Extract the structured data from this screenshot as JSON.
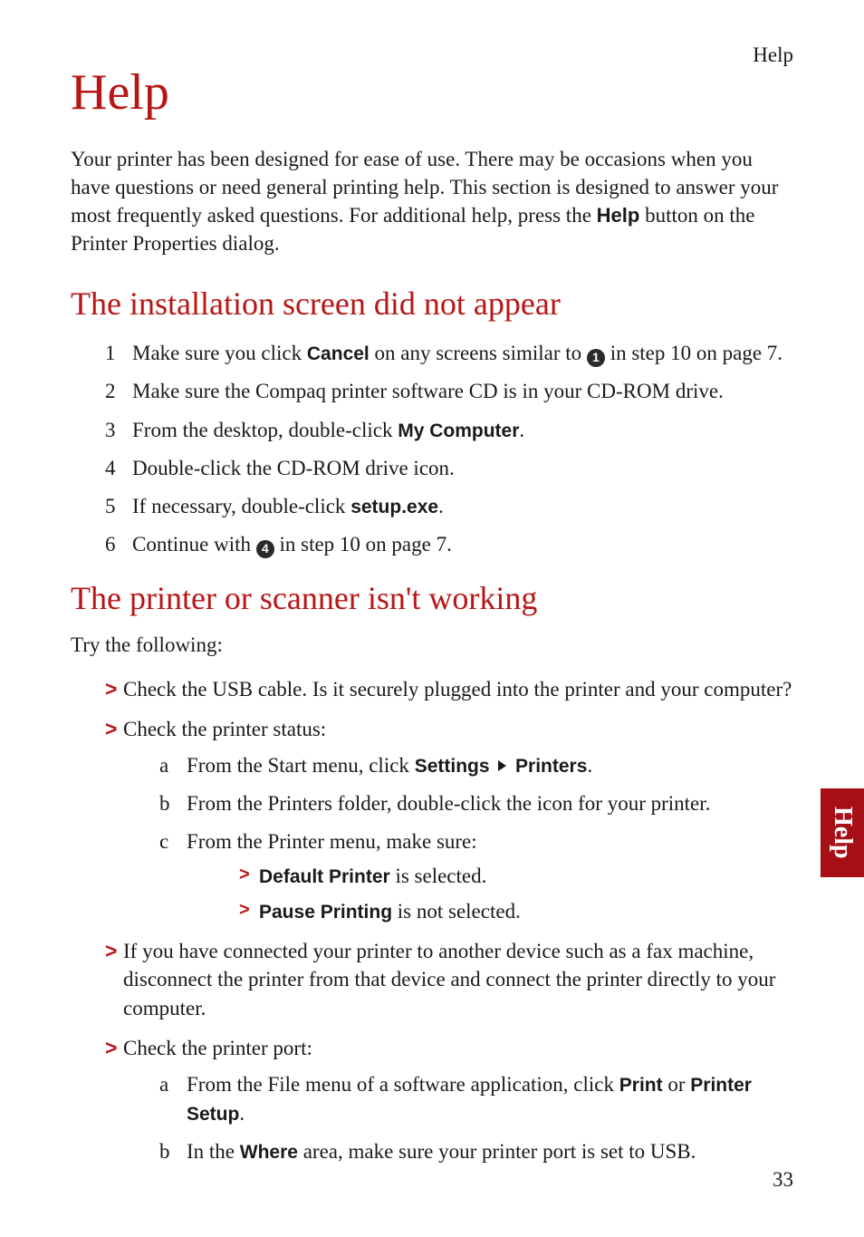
{
  "header": {
    "label": "Help"
  },
  "title": "Help",
  "intro": {
    "text_before": "Your printer has been designed for ease of use. There may be occasions when you have questions or need general printing help. This section is designed to answer your most frequently asked questions. For additional help, press the ",
    "bold": "Help",
    "text_after": " button on the Printer Properties dialog."
  },
  "section1": {
    "heading": "The installation screen did not appear",
    "items": [
      {
        "num": "1",
        "pre": "Make sure you click ",
        "bold": "Cancel",
        "mid": " on any screens similar to ",
        "circ": "1",
        "post": " in step 10 on page 7."
      },
      {
        "num": "2",
        "text": "Make sure the Compaq printer software CD is in your CD-ROM drive."
      },
      {
        "num": "3",
        "pre": "From the desktop, double-click ",
        "bold": "My Computer",
        "post": "."
      },
      {
        "num": "4",
        "text": "Double-click the CD-ROM drive icon."
      },
      {
        "num": "5",
        "pre": "If necessary, double-click ",
        "bold": "setup.exe",
        "post": "."
      },
      {
        "num": "6",
        "pre": "Continue with ",
        "circ": "4",
        "post": " in step 10 on page 7."
      }
    ]
  },
  "section2": {
    "heading": "The printer or scanner isn't working",
    "try": "Try the following:",
    "b1": {
      "text": "Check the USB cable. Is it securely plugged into the printer and your computer?"
    },
    "b2": {
      "text": "Check the printer status:",
      "sub": {
        "a": {
          "letter": "a",
          "pre": "From the Start menu, click ",
          "b1": "Settings",
          "b2": "Printers",
          "post": "."
        },
        "b": {
          "letter": "b",
          "text": "From the Printers folder, double-click the icon for your printer."
        },
        "c": {
          "letter": "c",
          "text": "From the Printer menu, make sure:",
          "nested": [
            {
              "bold": "Default Printer",
              "text": " is selected."
            },
            {
              "bold": "Pause Printing",
              "text": " is not selected."
            }
          ]
        }
      }
    },
    "b3": {
      "text": "If you have connected your printer to another device such as a fax machine, disconnect the printer from that device and connect the printer directly to your computer."
    },
    "b4": {
      "text": "Check the printer port:",
      "sub": {
        "a": {
          "letter": "a",
          "pre": "From the File menu of a software application, click ",
          "b1": "Print",
          "mid": " or ",
          "b2": "Printer Setup",
          "post": "."
        },
        "b": {
          "letter": "b",
          "pre": "In the ",
          "bold": "Where",
          "post": " area, make sure your printer port is set to USB."
        }
      }
    }
  },
  "sidetab": "Help",
  "pagenum": "33"
}
